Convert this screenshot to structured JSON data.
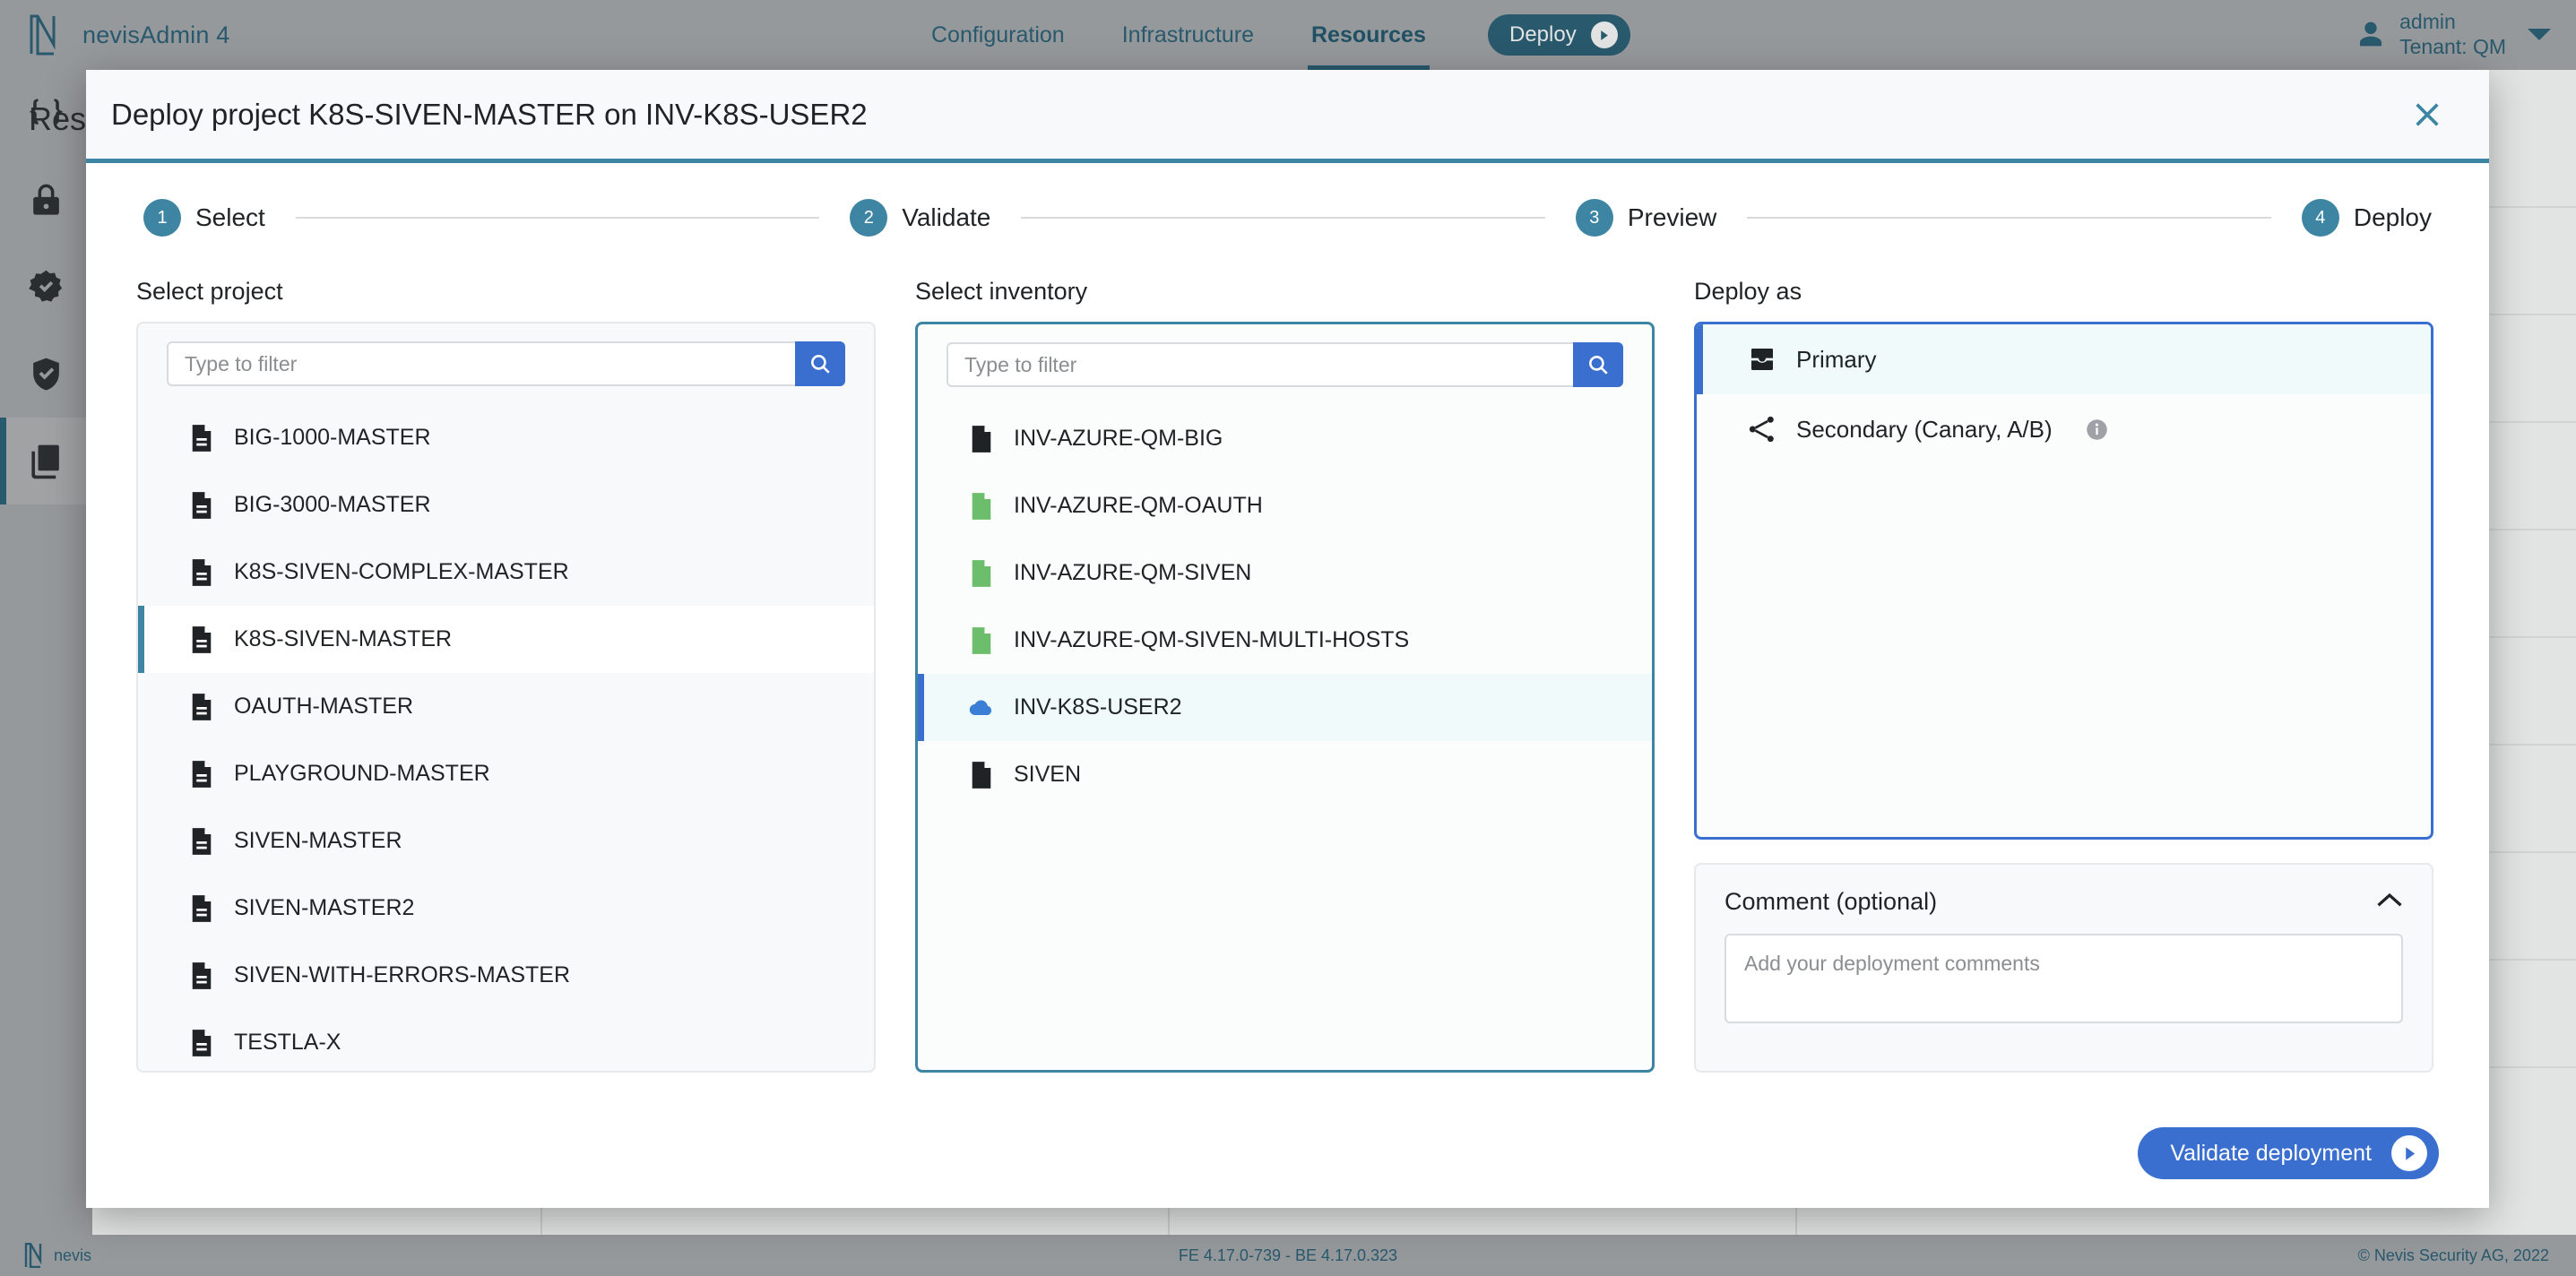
{
  "app": {
    "brand": "nevisAdmin 4",
    "nav": [
      {
        "label": "Configuration",
        "active": false
      },
      {
        "label": "Infrastructure",
        "active": false
      },
      {
        "label": "Resources",
        "active": true
      }
    ],
    "deploy_button": "Deploy",
    "user": {
      "name": "admin",
      "tenant": "Tenant: QM"
    },
    "page_heading": "Resou",
    "sidebar": [
      {
        "name": "braces-icon",
        "active": false
      },
      {
        "name": "lock-icon",
        "active": false
      },
      {
        "name": "verified-badge-icon",
        "active": false
      },
      {
        "name": "shield-check-icon",
        "active": false
      },
      {
        "name": "documents-icon",
        "active": true
      }
    ],
    "footer": {
      "brand": "nevis",
      "version": "FE 4.17.0-739 - BE 4.17.0.323",
      "copyright": "© Nevis Security AG, 2022"
    }
  },
  "modal": {
    "title": "Deploy project K8S-SIVEN-MASTER on INV-K8S-USER2",
    "close_icon": "close-icon",
    "steps": [
      {
        "num": "1",
        "label": "Select"
      },
      {
        "num": "2",
        "label": "Validate"
      },
      {
        "num": "3",
        "label": "Preview"
      },
      {
        "num": "4",
        "label": "Deploy"
      }
    ],
    "project_panel": {
      "label": "Select project",
      "filter_placeholder": "Type to filter",
      "filter_value": "",
      "search_icon": "search-icon",
      "items": [
        {
          "label": "BIG-1000-MASTER",
          "icon": "document-icon",
          "icon_color": "#1f2326",
          "selected": false
        },
        {
          "label": "BIG-3000-MASTER",
          "icon": "document-icon",
          "icon_color": "#1f2326",
          "selected": false
        },
        {
          "label": "K8S-SIVEN-COMPLEX-MASTER",
          "icon": "document-icon",
          "icon_color": "#1f2326",
          "selected": false
        },
        {
          "label": "K8S-SIVEN-MASTER",
          "icon": "document-icon",
          "icon_color": "#1f2326",
          "selected": true
        },
        {
          "label": "OAUTH-MASTER",
          "icon": "document-icon",
          "icon_color": "#1f2326",
          "selected": false
        },
        {
          "label": "PLAYGROUND-MASTER",
          "icon": "document-icon",
          "icon_color": "#1f2326",
          "selected": false
        },
        {
          "label": "SIVEN-MASTER",
          "icon": "document-icon",
          "icon_color": "#1f2326",
          "selected": false
        },
        {
          "label": "SIVEN-MASTER2",
          "icon": "document-icon",
          "icon_color": "#1f2326",
          "selected": false
        },
        {
          "label": "SIVEN-WITH-ERRORS-MASTER",
          "icon": "document-icon",
          "icon_color": "#1f2326",
          "selected": false
        },
        {
          "label": "TESTLA-X",
          "icon": "document-icon",
          "icon_color": "#1f2326",
          "selected": false
        }
      ]
    },
    "inventory_panel": {
      "label": "Select inventory",
      "filter_placeholder": "Type to filter",
      "filter_value": "",
      "search_icon": "search-icon",
      "items": [
        {
          "label": "INV-AZURE-QM-BIG",
          "icon": "file-icon",
          "icon_color": "#1f2326",
          "selected": false
        },
        {
          "label": "INV-AZURE-QM-OAUTH",
          "icon": "file-icon",
          "icon_color": "#6cbe6c",
          "selected": false
        },
        {
          "label": "INV-AZURE-QM-SIVEN",
          "icon": "file-icon",
          "icon_color": "#6cbe6c",
          "selected": false
        },
        {
          "label": "INV-AZURE-QM-SIVEN-MULTI-HOSTS",
          "icon": "file-icon",
          "icon_color": "#6cbe6c",
          "selected": false
        },
        {
          "label": "INV-K8S-USER2",
          "icon": "cloud-icon",
          "icon_color": "#3a7fd5",
          "selected": true
        },
        {
          "label": "SIVEN",
          "icon": "file-icon",
          "icon_color": "#1f2326",
          "selected": false
        }
      ]
    },
    "deploy_as": {
      "label": "Deploy as",
      "options": [
        {
          "label": "Primary",
          "icon": "inbox-icon",
          "selected": true,
          "has_info": false
        },
        {
          "label": "Secondary (Canary, A/B)",
          "icon": "share-fork-icon",
          "selected": false,
          "has_info": true,
          "info_icon": "info-icon"
        }
      ]
    },
    "comment": {
      "title": "Comment (optional)",
      "collapse_icon": "chevron-up-icon",
      "placeholder": "Add your deployment comments",
      "value": ""
    },
    "primary_action": {
      "label": "Validate deployment",
      "icon": "play-icon"
    }
  },
  "colors": {
    "brand_teal": "#2d6279",
    "accent_teal": "#3d85a3",
    "accent_blue": "#3a6fd0",
    "topbar_gray": "#a9abad",
    "panel_bg": "#f8f9fa",
    "green_file": "#6cbe6c",
    "cloud_blue": "#3a7fd5"
  }
}
